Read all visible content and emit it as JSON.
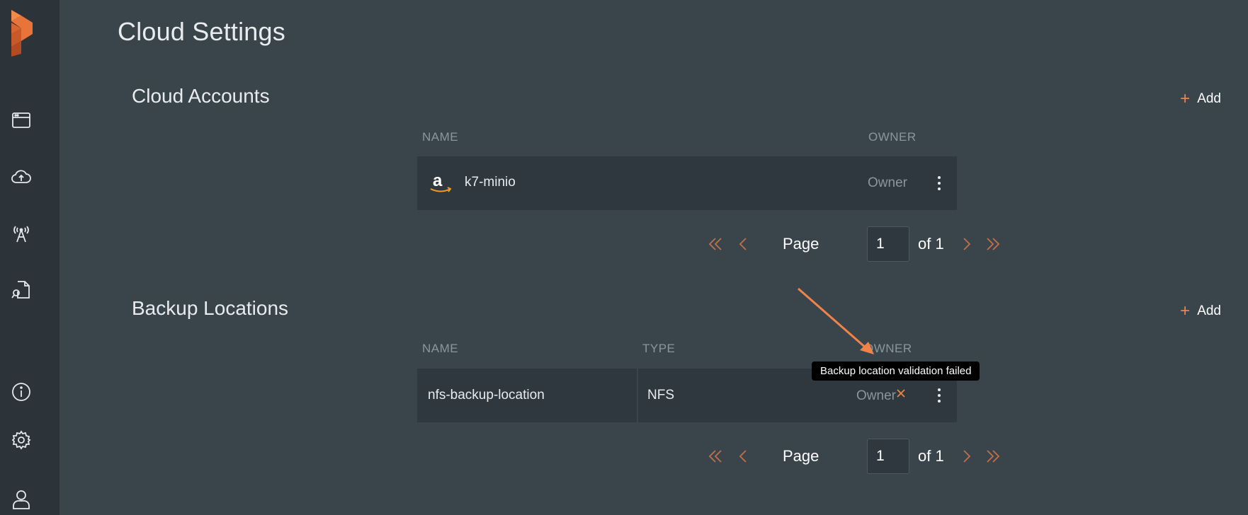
{
  "page": {
    "title": "Cloud Settings"
  },
  "sidebar": {
    "items": [
      {
        "name": "dashboard-icon"
      },
      {
        "name": "cloud-upload-icon"
      },
      {
        "name": "antenna-icon"
      },
      {
        "name": "document-search-icon"
      },
      {
        "name": "info-icon"
      },
      {
        "name": "gear-icon"
      },
      {
        "name": "user-icon"
      }
    ]
  },
  "cloud_accounts": {
    "title": "Cloud Accounts",
    "add_label": "Add",
    "columns": {
      "name": "NAME",
      "owner": "OWNER"
    },
    "rows": [
      {
        "provider_icon": "amazon-icon",
        "name": "k7-minio",
        "owner": "Owner"
      }
    ],
    "pager": {
      "page_label": "Page",
      "page_value": "1",
      "of_label": "of 1"
    }
  },
  "backup_locations": {
    "title": "Backup Locations",
    "add_label": "Add",
    "columns": {
      "name": "NAME",
      "type": "TYPE",
      "owner": "OWNER"
    },
    "rows": [
      {
        "name": "nfs-backup-location",
        "type": "NFS",
        "status_icon": "close-icon",
        "owner": "Owner"
      }
    ],
    "tooltip": "Backup location validation failed",
    "pager": {
      "page_label": "Page",
      "page_value": "1",
      "of_label": "of 1"
    }
  },
  "colors": {
    "accent": "#f0834a",
    "background": "#3a444b",
    "sidebar": "#2c3439",
    "row": "#2f383e"
  }
}
